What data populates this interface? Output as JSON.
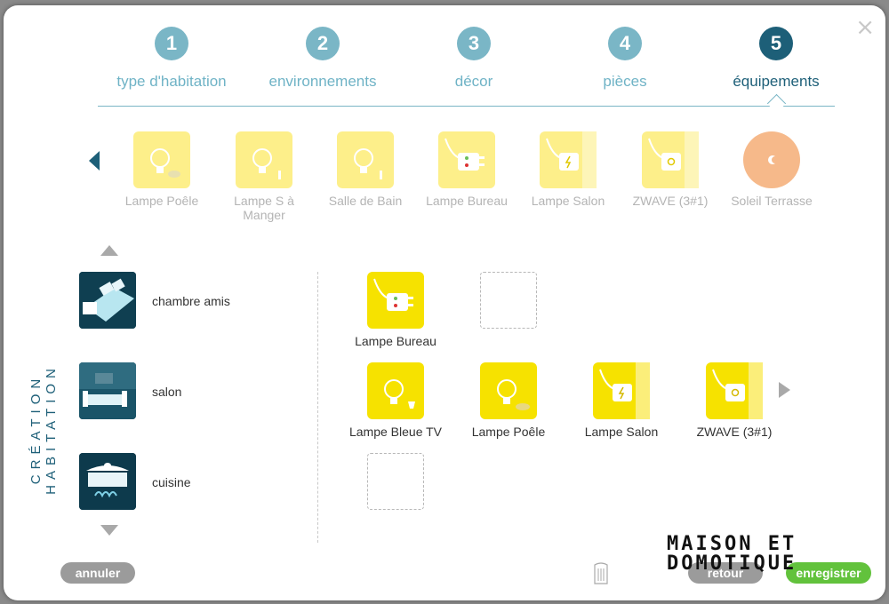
{
  "steps": [
    {
      "num": "1",
      "label": "type d'habitation",
      "active": false
    },
    {
      "num": "2",
      "label": "environnements",
      "active": false
    },
    {
      "num": "3",
      "label": "décor",
      "active": false
    },
    {
      "num": "4",
      "label": "pièces",
      "active": false
    },
    {
      "num": "5",
      "label": "équipements",
      "active": true
    }
  ],
  "close_glyph": "×",
  "carousel": [
    {
      "label": "Lampe Poêle",
      "icon": "bulb-icon"
    },
    {
      "label": "Lampe S à Manger",
      "icon": "bulb-icon"
    },
    {
      "label": "Salle de Bain",
      "icon": "bulb-icon"
    },
    {
      "label": "Lampe Bureau",
      "icon": "plug-icon"
    },
    {
      "label": "Lampe Salon",
      "icon": "plug-icon"
    },
    {
      "label": "ZWAVE (3#1)",
      "icon": "plug-icon"
    },
    {
      "label": "Soleil Terrasse",
      "icon": "sun-icon"
    }
  ],
  "sidebar_title": "CRÉATION HABITATION",
  "rooms": [
    {
      "name": "chambre amis"
    },
    {
      "name": "salon"
    },
    {
      "name": "cuisine"
    }
  ],
  "devices": {
    "row1": [
      {
        "label": "Lampe Bureau"
      }
    ],
    "row2": [
      {
        "label": "Lampe Bleue TV"
      },
      {
        "label": "Lampe Poêle"
      },
      {
        "label": "Lampe Salon"
      },
      {
        "label": "ZWAVE (3#1)"
      }
    ]
  },
  "buttons": {
    "cancel": "annuler",
    "back": "retour",
    "save": "enregistrer"
  },
  "logo": {
    "line1": "MAISON ET",
    "line2": "DOMOTIQUE"
  },
  "colors": {
    "accent": "#1d5f78",
    "step": "#7ab6c6",
    "device": "#f6e200",
    "save": "#62c23c"
  }
}
